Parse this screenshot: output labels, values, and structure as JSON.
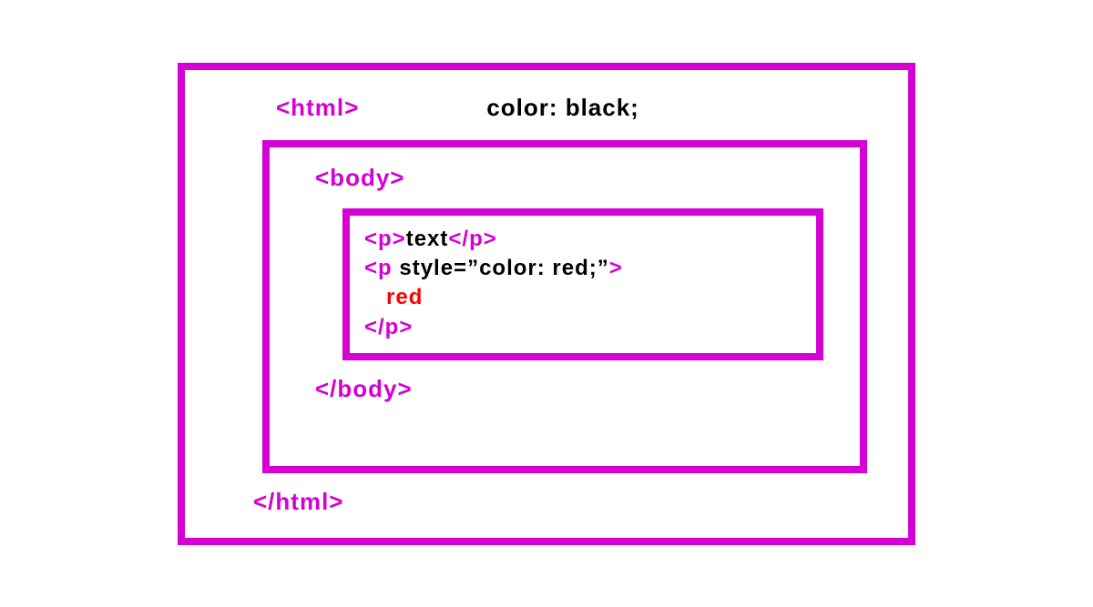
{
  "outer": {
    "open_tag": "<html>",
    "css_rule": "color: black;",
    "close_tag": "</html>"
  },
  "middle": {
    "open_tag": "<body>",
    "close_tag": "</body>"
  },
  "inner": {
    "line1_open": "<p>",
    "line1_text": "text",
    "line1_close": "</p>",
    "line2_open": "<p",
    "line2_attr": " style=”color: red;”",
    "line2_end": ">",
    "line3_text": "red",
    "line4_close": "</p>"
  },
  "colors": {
    "border": "#d400d4",
    "tag": "#d400d4",
    "text": "#000000",
    "red": "#ff0000"
  }
}
